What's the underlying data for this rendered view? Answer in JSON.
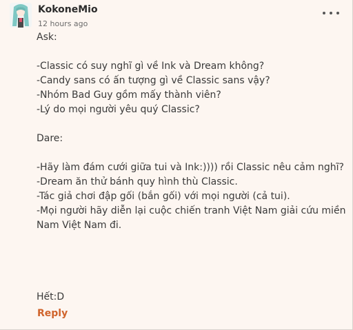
{
  "comment": {
    "username": "KokoneMio",
    "timestamp": "12 hours ago",
    "more_icon": "more-horizontal-icon",
    "body_lines": [
      "Ask:",
      "",
      "-Classic có suy nghĩ gì về Ink và Dream không?",
      "-Candy sans có ấn tượng gì về Classic sans vậy?",
      "-Nhóm Bad Guy gồm mấy thành viên?",
      "-Lý do mọi người yêu quý Classic?",
      "",
      "Dare:",
      "",
      "-Hãy làm đám cưới giữa tui và Ink:)))) rồi Classic nêu cảm nghĩ?",
      "-Dream ăn thử bánh quy hình thù Classic.",
      "-Tác giả chơi đập gối (bắn gối) với mọi người (cả tui).",
      "-Mọi người hãy diễn lại cuộc chiến tranh Việt Nam giải cứu miền",
      "Nam Việt Nam đi."
    ],
    "ending": "Hết:D",
    "reply_label": "Reply"
  },
  "colors": {
    "background": "#fdf6f1",
    "reply": "#d0642c",
    "avatar_hair": "#7ec8c4"
  }
}
